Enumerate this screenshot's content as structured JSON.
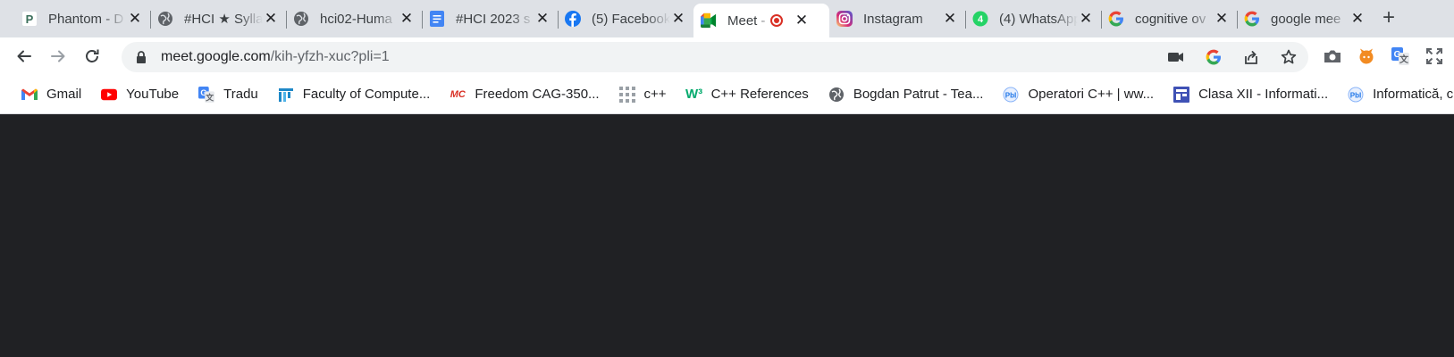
{
  "tabs": [
    {
      "title": "Phantom - D",
      "icon": "phantom-icon"
    },
    {
      "title": "#HCI ★ Sylla",
      "icon": "globe-icon"
    },
    {
      "title": "hci02-Huma",
      "icon": "globe-icon"
    },
    {
      "title": "#HCI 2023 s",
      "icon": "google-docs-icon"
    },
    {
      "title": "(5) Facebook",
      "icon": "facebook-icon"
    },
    {
      "title": "Meet - k",
      "icon": "google-meet-icon",
      "active": true,
      "recording": true
    },
    {
      "title": "Instagram",
      "icon": "instagram-icon"
    },
    {
      "title": "(4) WhatsApp",
      "icon": "whatsapp-icon"
    },
    {
      "title": "cognitive ov",
      "icon": "google-icon"
    },
    {
      "title": "google mee",
      "icon": "google-icon"
    }
  ],
  "newtab_label": "+",
  "close_glyph": "✕",
  "address": {
    "host": "meet.google.com",
    "path": "/kih-yfzh-xuc?pli=1"
  },
  "omnibox_icons": [
    "camera-blocked-icon",
    "google-lens-icon",
    "share-icon",
    "bookmark-star-icon"
  ],
  "extension_icons": [
    "screenshot-camera-icon",
    "extension-fox-icon",
    "google-translate-icon",
    "fullscreen-icon"
  ],
  "bookmarks": [
    {
      "label": "Gmail",
      "icon": "gmail-icon"
    },
    {
      "label": "YouTube",
      "icon": "youtube-icon"
    },
    {
      "label": "Tradu",
      "icon": "google-translate-icon"
    },
    {
      "label": "Faculty of Compute...",
      "icon": "faculty-icon"
    },
    {
      "label": "Freedom CAG-350...",
      "icon": "freedom-icon"
    },
    {
      "label": "c++",
      "icon": "grid-icon"
    },
    {
      "label": "C++ References",
      "icon": "w3-icon"
    },
    {
      "label": "Bogdan Patrut - Tea...",
      "icon": "globe-icon"
    },
    {
      "label": "Operatori C++ | ww...",
      "icon": "pbinfo-icon"
    },
    {
      "label": "Clasa XII - Informati...",
      "icon": "site-icon"
    },
    {
      "label": "Informatică, clasa",
      "icon": "pbinfo-icon"
    }
  ],
  "colors": {
    "tabstrip": "#dee1e6",
    "toolbar": "#ffffff",
    "omnibox": "#f1f3f4",
    "content": "#202124",
    "record": "#d93025"
  }
}
